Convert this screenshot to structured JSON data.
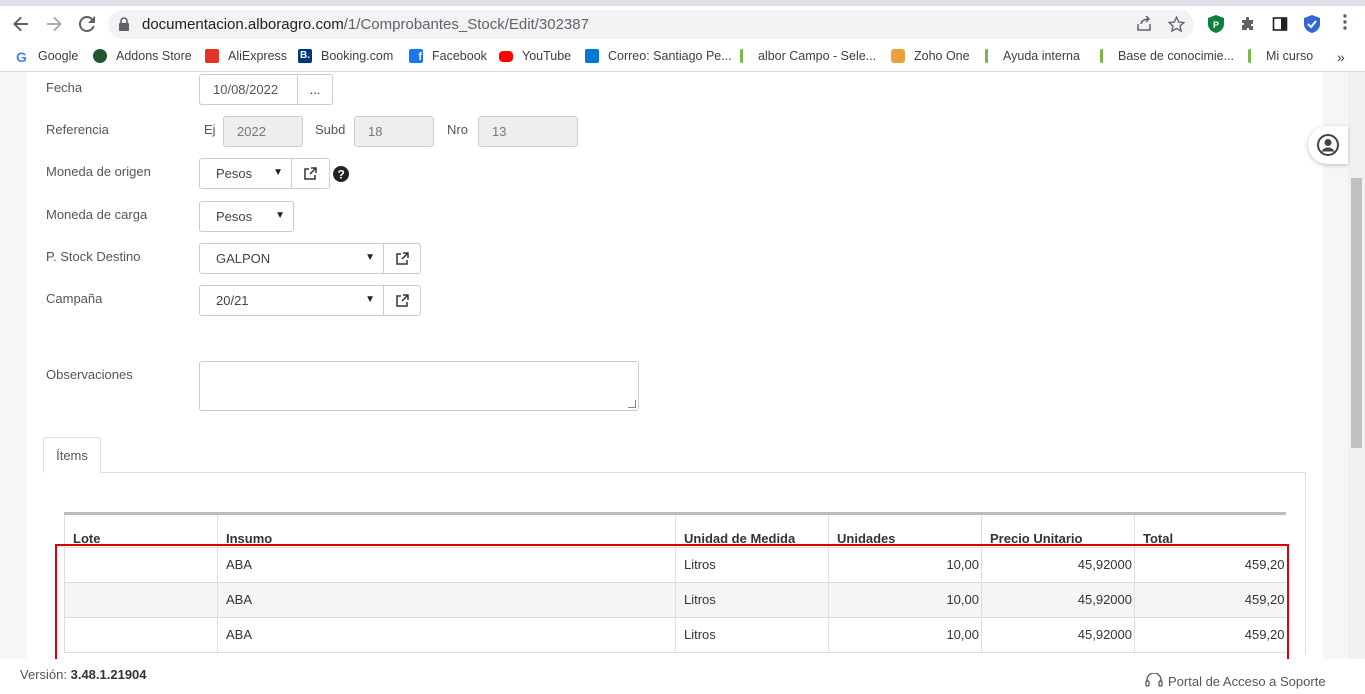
{
  "browser": {
    "url_host": "documentacion.alboragro.com",
    "url_path": "/1/Comprobantes_Stock/Edit/302387",
    "bookmarks": [
      {
        "label": "Google",
        "icon": "google-icon",
        "color": "#4285f4"
      },
      {
        "label": "Addons Store",
        "icon": "addons-store-icon",
        "color": "#1e5631"
      },
      {
        "label": "AliExpress",
        "icon": "aliexpress-icon",
        "color": "#e43225"
      },
      {
        "label": "Booking.com",
        "icon": "booking-icon",
        "color": "#003580"
      },
      {
        "label": "Facebook",
        "icon": "facebook-icon",
        "color": "#1877f2"
      },
      {
        "label": "YouTube",
        "icon": "youtube-icon",
        "color": "#ff0000"
      },
      {
        "label": "Correo: Santiago Pe...",
        "icon": "outlook-icon",
        "color": "#0078d4"
      },
      {
        "label": "albor Campo - Sele...",
        "icon": "albor-icon",
        "color": "#7ab648"
      },
      {
        "label": "Zoho One",
        "icon": "zoho-icon",
        "color": "#e8a33d"
      },
      {
        "label": "Ayuda interna",
        "icon": "albor-help-icon",
        "color": "#7ab648"
      },
      {
        "label": "Base de conocimie...",
        "icon": "albor-kb-icon",
        "color": "#7ab648"
      },
      {
        "label": "Mi curso",
        "icon": "albor-course-icon",
        "color": "#7ab648"
      }
    ],
    "more_bookmarks": "»"
  },
  "form": {
    "fecha_label": "Fecha",
    "fecha_value": "10/08/2022",
    "fecha_btn": "...",
    "referencia_label": "Referencia",
    "ej_label": "Ej",
    "ej_value": "2022",
    "subd_label": "Subd",
    "subd_value": "18",
    "nro_label": "Nro",
    "nro_value": "13",
    "moneda_origen_label": "Moneda de origen",
    "moneda_origen_value": "Pesos",
    "moneda_carga_label": "Moneda de carga",
    "moneda_carga_value": "Pesos",
    "stock_destino_label": "P. Stock Destino",
    "stock_destino_value": "GALPON",
    "campana_label": "Campaña",
    "campana_value": "20/21",
    "observaciones_label": "Observaciones",
    "observaciones_value": ""
  },
  "tabs": {
    "items_label": "Ítems"
  },
  "grid": {
    "columns": [
      "Lote",
      "Insumo",
      "Unidad de Medida",
      "Unidades",
      "Precio Unitario",
      "Total"
    ],
    "rows": [
      [
        "",
        "ABA",
        "Litros",
        "10,00",
        "45,92000",
        "459,20"
      ],
      [
        "",
        "ABA",
        "Litros",
        "10,00",
        "45,92000",
        "459,20"
      ],
      [
        "",
        "ABA",
        "Litros",
        "10,00",
        "45,92000",
        "459,20"
      ]
    ]
  },
  "footer": {
    "version_label": "Versión:",
    "version_value": "3.48.1.21904",
    "support_label": "Portal de Acceso a Soporte"
  },
  "colors": {
    "highlight": "#e00000",
    "accent": "#5b6770"
  }
}
